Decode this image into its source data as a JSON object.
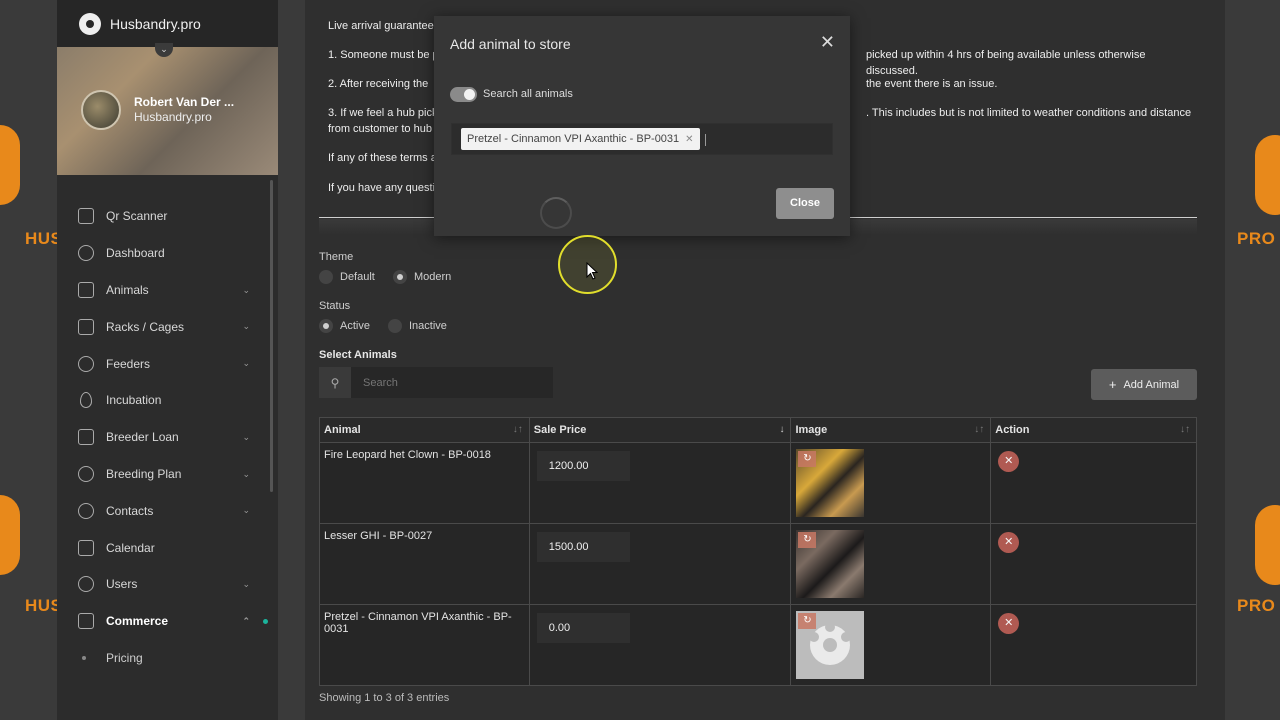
{
  "brand": {
    "name": "Husbandry.pro",
    "side_mark_left": "HUS",
    "side_mark_right": "PRO"
  },
  "profile": {
    "name": "Robert Van Der ...",
    "subtitle": "Husbandry.pro"
  },
  "nav": [
    {
      "label": "Qr Scanner",
      "icon": "qr-icon"
    },
    {
      "label": "Dashboard",
      "icon": "dashboard-icon"
    },
    {
      "label": "Animals",
      "icon": "snake-icon",
      "expandable": true
    },
    {
      "label": "Racks / Cages",
      "icon": "rack-icon",
      "expandable": true
    },
    {
      "label": "Feeders",
      "icon": "feeder-icon",
      "expandable": true
    },
    {
      "label": "Incubation",
      "icon": "egg-icon"
    },
    {
      "label": "Breeder Loan",
      "icon": "handshake-icon",
      "expandable": true
    },
    {
      "label": "Breeding Plan",
      "icon": "plan-icon",
      "expandable": true
    },
    {
      "label": "Contacts",
      "icon": "contacts-icon",
      "expandable": true
    },
    {
      "label": "Calendar",
      "icon": "calendar-icon"
    },
    {
      "label": "Users",
      "icon": "users-icon",
      "expandable": true
    },
    {
      "label": "Commerce",
      "icon": "dollar-icon",
      "expandable": true,
      "active": true
    }
  ],
  "nav_sub": {
    "pricing": "Pricing"
  },
  "terms": {
    "line0": "Live arrival guarantee",
    "line1": "1. Someone must be p",
    "line1b": "picked up within 4 hrs of being available unless otherwise discussed.",
    "line2": "2. After receiving the",
    "line2b": "the event there is an issue.",
    "line3": "3. If we feel a hub pick",
    "line3b": ". This includes but is not limited to weather conditions and distance",
    "line3c": "from customer to hub",
    "line4": "If any of these terms a",
    "line5": "If you have any questi"
  },
  "theme": {
    "label": "Theme",
    "options": [
      "Default",
      "Modern"
    ],
    "selected": "Modern"
  },
  "status": {
    "label": "Status",
    "options": [
      "Active",
      "Inactive"
    ],
    "selected": "Active"
  },
  "select_animals": {
    "label": "Select Animals",
    "search_placeholder": "Search",
    "add_button": "Add Animal"
  },
  "table": {
    "headers": [
      "Animal",
      "Sale Price",
      "Image",
      "Action"
    ],
    "rows": [
      {
        "animal": "Fire Leopard het Clown - BP-0018",
        "price": "1200.00"
      },
      {
        "animal": "Lesser GHI - BP-0027",
        "price": "1500.00"
      },
      {
        "animal": "Pretzel - Cinnamon VPI Axanthic - BP-0031",
        "price": "0.00"
      }
    ],
    "footer": "Showing 1 to 3 of 3 entries"
  },
  "modal": {
    "title": "Add animal to store",
    "toggle_label": "Search all animals",
    "selected_chip": "Pretzel - Cinnamon VPI Axanthic - BP-0031",
    "close_button": "Close"
  }
}
